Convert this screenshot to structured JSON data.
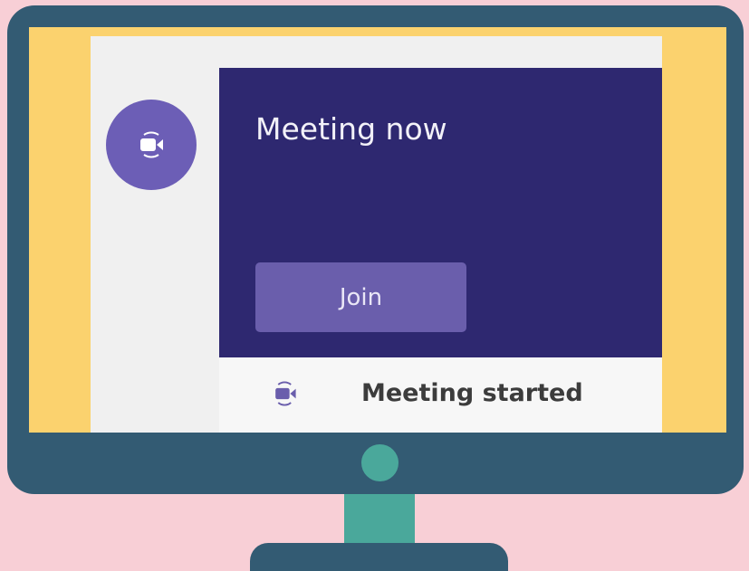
{
  "meeting_card": {
    "title": "Meeting now",
    "join_label": "Join"
  },
  "activity": {
    "status_text": "Meeting started"
  },
  "icons": {
    "avatar": "video-camera-icon",
    "row": "video-camera-icon"
  },
  "colors": {
    "background": "#f8cfd6",
    "monitor": "#335b73",
    "bezel": "#fbd26e",
    "card_header": "#2e2870",
    "accent": "#6a5eac",
    "stand": "#4aa89b"
  }
}
